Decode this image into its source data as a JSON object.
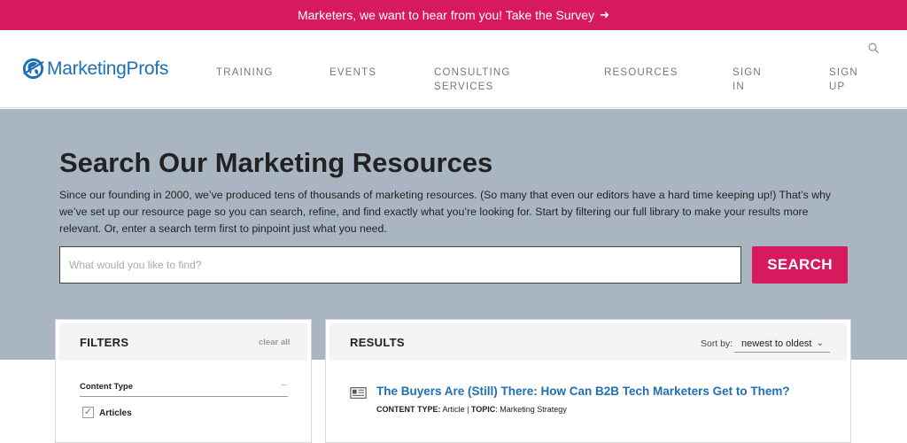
{
  "banner": {
    "text": "Marketers, we want to hear from you! Take the Survey",
    "arrow": "➜"
  },
  "header": {
    "logo_text": "MarketingProfs",
    "nav": [
      {
        "line1": "TRAINING",
        "line2": ""
      },
      {
        "line1": "EVENTS",
        "line2": ""
      },
      {
        "line1": "CONSULTING",
        "line2": "SERVICES"
      },
      {
        "line1": "RESOURCES",
        "line2": ""
      },
      {
        "line1": "SIGN",
        "line2": "IN"
      },
      {
        "line1": "SIGN",
        "line2": "UP"
      }
    ]
  },
  "hero": {
    "title": "Search Our Marketing Resources",
    "description": "Since our founding in 2000, we’ve produced tens of thousands of marketing resources. (So many that even our editors have a hard time keeping up!) That’s why we’ve set up our resource page so you can search, refine, and find exactly what you’re looking for. Start by filtering our full library to make your results more relevant. Or, enter a search term first to pinpoint just what you need.",
    "search_placeholder": "What would you like to find?",
    "search_value": "",
    "search_button": "SEARCH"
  },
  "filters": {
    "title": "FILTERS",
    "clear_all": "clear all",
    "content_type_label": "Content Type",
    "collapse_glyph": "–",
    "items": [
      {
        "label": "Articles",
        "checked": true,
        "mark": "✓"
      }
    ]
  },
  "results": {
    "title": "RESULTS",
    "sort_label": "Sort by:",
    "sort_value": "newest to oldest",
    "items": [
      {
        "title": "The Buyers Are (Still) There: How Can B2B Tech Marketers Get to Them?",
        "content_type_key": "CONTENT TYPE:",
        "content_type": "Article",
        "separator": "|",
        "topic_key": "TOPIC",
        "topic": "Marketing Strategy"
      }
    ]
  },
  "colors": {
    "brand_pink": "#d7195e",
    "brand_blue": "#1f6fb2",
    "hero_bg": "#a9b6c2"
  }
}
